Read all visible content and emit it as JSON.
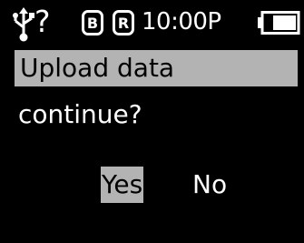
{
  "status_bar": {
    "usb_icon": "usb-icon",
    "usb_status": "?",
    "badge_b": "B",
    "badge_r": "R",
    "time": "10:00P",
    "battery_icon": "battery-icon"
  },
  "dialog": {
    "line1": "Upload data",
    "line2": "continue?",
    "options": {
      "yes": "Yes",
      "no": "No"
    },
    "selected_option": "Yes"
  },
  "colors": {
    "background": "#000000",
    "text": "#ffffff",
    "highlight": "#b3b3b3",
    "highlight_text": "#000000"
  }
}
